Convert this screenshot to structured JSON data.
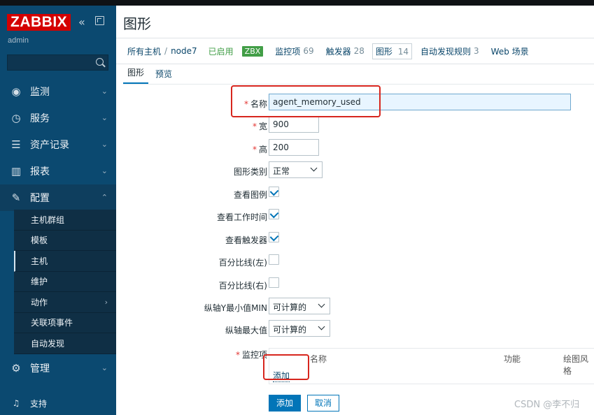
{
  "sidebar": {
    "logo": "ZABBIX",
    "user": "admin",
    "collapse_glyph": "«",
    "nav": [
      {
        "label": "监测",
        "icon": "eye-icon"
      },
      {
        "label": "服务",
        "icon": "clock-icon"
      },
      {
        "label": "资产记录",
        "icon": "list-icon"
      },
      {
        "label": "报表",
        "icon": "bar-chart-icon"
      },
      {
        "label": "配置",
        "icon": "wrench-icon"
      },
      {
        "label": "管理",
        "icon": "gear-icon"
      },
      {
        "label": "支持",
        "icon": "headset-icon"
      }
    ],
    "submenu": [
      {
        "label": "主机群组"
      },
      {
        "label": "模板"
      },
      {
        "label": "主机"
      },
      {
        "label": "维护"
      },
      {
        "label": "动作"
      },
      {
        "label": "关联项事件"
      },
      {
        "label": "自动发现"
      }
    ]
  },
  "main": {
    "title": "图形",
    "breadcrumb": {
      "all_hosts": "所有主机",
      "sep": "/",
      "host": "node7",
      "enabled": "已启用",
      "zbx": "ZBX",
      "items_label": "监控项",
      "items_count": "69",
      "triggers_label": "触发器",
      "triggers_count": "28",
      "graphs_label": "图形",
      "graphs_count": "14",
      "discovery_label": "自动发现规则",
      "discovery_count": "3",
      "web_label": "Web 场景"
    },
    "tabs": [
      {
        "label": "图形"
      },
      {
        "label": "预览"
      }
    ],
    "form": {
      "name_label": "名称",
      "name_value": "agent_memory_used",
      "width_label": "宽",
      "width_value": "900",
      "height_label": "高",
      "height_value": "200",
      "type_label": "图形类别",
      "type_value": "正常",
      "legend_label": "查看图例",
      "worktime_label": "查看工作时间",
      "triggers_label": "查看触发器",
      "pct_left_label": "百分比线(左)",
      "pct_right_label": "百分比线(右)",
      "ymin_label": "纵轴Y最小值MIN",
      "ymin_value": "可计算的",
      "ymax_label": "纵轴最大值",
      "ymax_value": "可计算的",
      "items_label": "监控项",
      "items_col_name": "名称",
      "items_col_func": "功能",
      "items_col_style": "绘图风格",
      "items_add": "添加",
      "required_mark": "*",
      "checkbox_states": {
        "legend": true,
        "worktime": true,
        "triggers": true,
        "pct_left": false,
        "pct_right": false
      }
    },
    "buttons": {
      "add": "添加",
      "cancel": "取消"
    }
  },
  "watermark": "CSDN @李不归",
  "colors": {
    "sidebar": "#0b4970",
    "logo": "#d40000",
    "primary": "#0275b8",
    "enabled_green": "#429e47",
    "highlight_red": "#d7261e"
  }
}
